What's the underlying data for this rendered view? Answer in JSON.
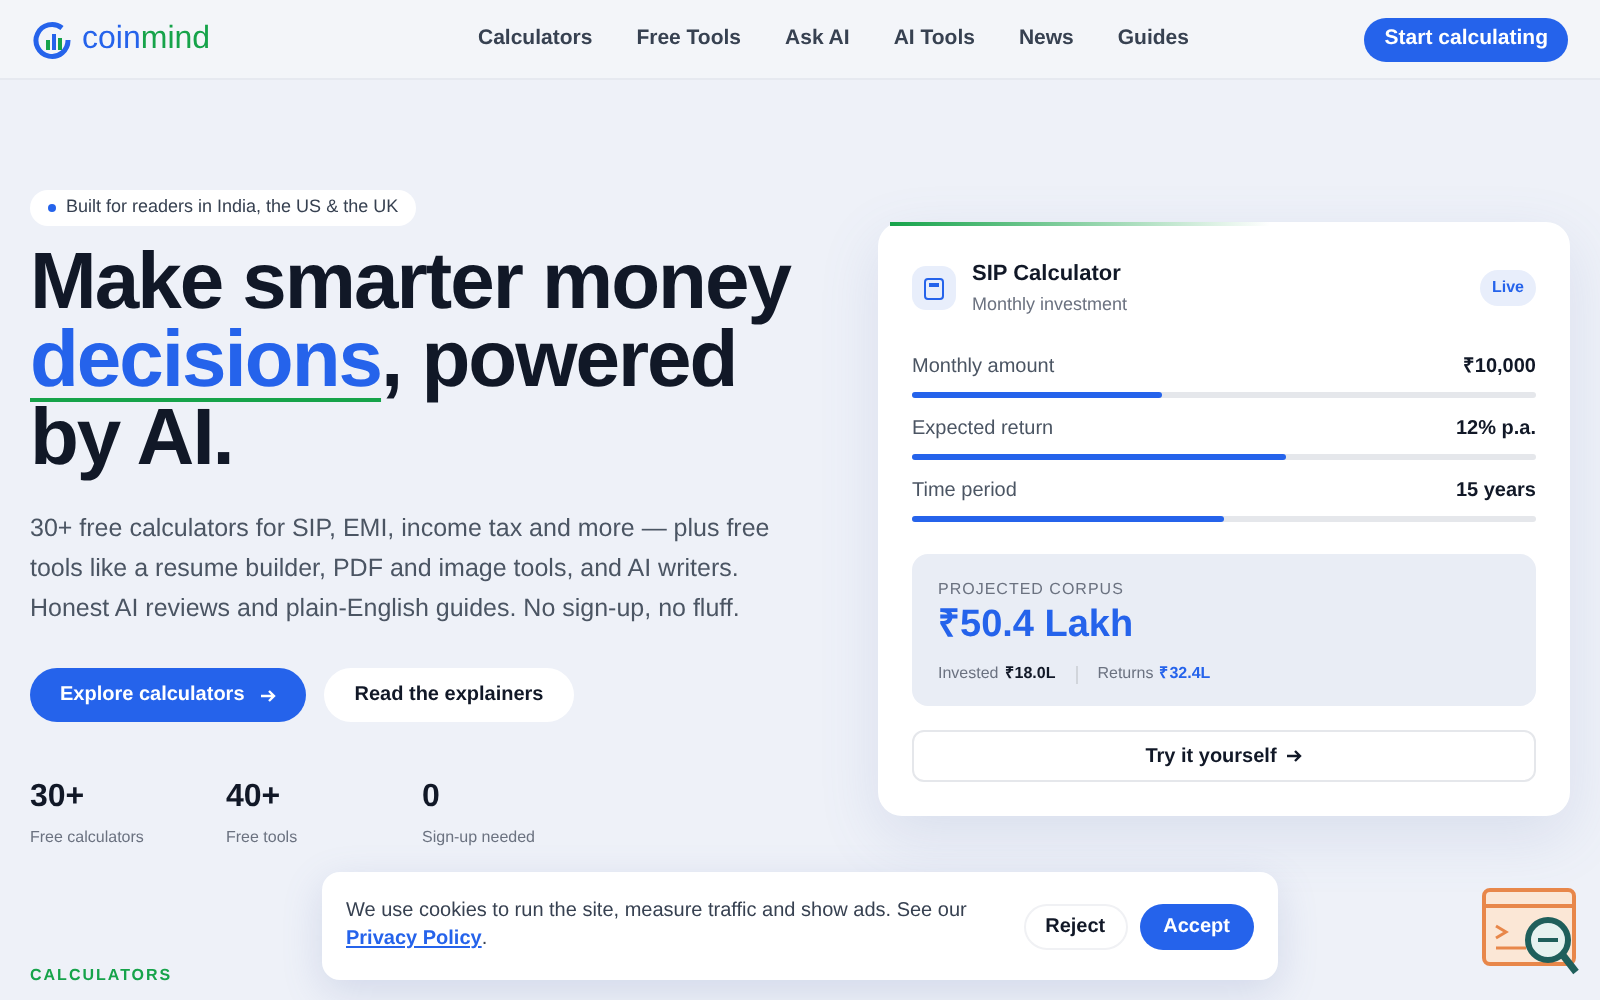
{
  "logo": {
    "first": "coin",
    "second": "mind"
  },
  "nav": [
    {
      "label": "Calculators"
    },
    {
      "label": "Free Tools"
    },
    {
      "label": "Ask AI"
    },
    {
      "label": "AI Tools"
    },
    {
      "label": "News"
    },
    {
      "label": "Guides"
    }
  ],
  "cta": "Start calculating",
  "badge": "Built for readers in India, the US & the UK",
  "headline": {
    "before": "Make smarter money ",
    "highlight": "decisions",
    "after": ", powered by AI."
  },
  "intro": "30+ free calculators for SIP, EMI, income tax and more — plus free tools like a resume builder, PDF and image tools, and AI writers. Honest AI reviews and plain-English guides. No sign-up, no fluff.",
  "buttons": [
    {
      "label": "Explore calculators",
      "kind": "primary"
    },
    {
      "label": "Read the explainers",
      "kind": "secondary"
    }
  ],
  "stats": [
    {
      "value": "30+",
      "label": "Free calculators"
    },
    {
      "value": "40+",
      "label": "Free tools"
    },
    {
      "value": "0",
      "label": "Sign-up needed"
    }
  ],
  "card": {
    "title": "SIP Calculator",
    "subtitle": "Monthly investment",
    "status": "Live",
    "sliders": [
      {
        "label": "Monthly amount",
        "value": "₹10,000",
        "level": 0.4
      },
      {
        "label": "Expected return",
        "value": "12% p.a.",
        "level": 0.6
      },
      {
        "label": "Time period",
        "value": "15 years",
        "level": 0.5
      }
    ],
    "result": {
      "label": "PROJECTED CORPUS",
      "value": "₹50.4 Lakh",
      "invested_label": "Invested",
      "invested": "₹18.0L",
      "returns_label": "Returns",
      "returns": "₹32.4L"
    },
    "button": "Try it yourself"
  },
  "section_label": "CALCULATORS",
  "cookie": {
    "text": "We use cookies to run the site, measure traffic and show ads. See our ",
    "link": "Privacy Policy",
    "end": ".",
    "buttons": [
      {
        "label": "Reject",
        "kind": "secondary"
      },
      {
        "label": "Accept",
        "kind": "primary"
      }
    ]
  }
}
